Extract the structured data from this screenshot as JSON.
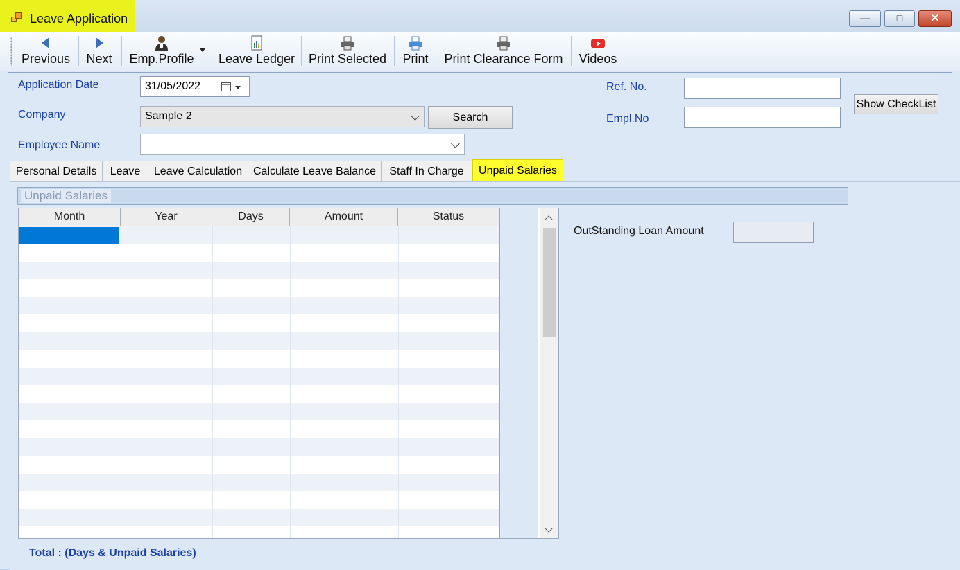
{
  "window": {
    "title": "Leave Application",
    "icon": "app-window-icon",
    "highlight_color": "#e9f21c",
    "controls": [
      "minimize",
      "maximize",
      "close"
    ]
  },
  "toolbar": {
    "items": [
      {
        "label": "Previous",
        "icon": "arrow-left-icon"
      },
      {
        "label": "Next",
        "icon": "arrow-right-icon"
      },
      {
        "label": "Emp.Profile",
        "icon": "person-icon",
        "dropdown": true
      },
      {
        "label": "Leave Ledger",
        "icon": "ledger-icon"
      },
      {
        "label": "Print Selected",
        "icon": "printer-icon"
      },
      {
        "label": "Print",
        "icon": "printer-icon"
      },
      {
        "label": "Print Clearance Form",
        "icon": "printer-icon"
      },
      {
        "label": "Videos",
        "icon": "youtube-icon"
      }
    ]
  },
  "form": {
    "application_date_label": "Application Date",
    "application_date_value": "31/05/2022",
    "company_label": "Company",
    "company_value": "Sample 2",
    "search_button": "Search",
    "employee_name_label": "Employee Name",
    "employee_name_value": "",
    "ref_no_label": "Ref. No.",
    "ref_no_value": "",
    "empl_no_label": "Empl.No",
    "empl_no_value": "",
    "show_checklist_button": "Show CheckList"
  },
  "tabs": [
    {
      "label": "Personal Details",
      "active": false
    },
    {
      "label": "Leave",
      "active": false
    },
    {
      "label": "Leave Calculation",
      "active": false
    },
    {
      "label": "Calculate Leave Balance",
      "active": false
    },
    {
      "label": "Staff In Charge",
      "active": false
    },
    {
      "label": "Unpaid Salaries",
      "active": true
    }
  ],
  "unpaid": {
    "group_title": "Unpaid Salaries",
    "columns": [
      "Month",
      "Year",
      "Days",
      "Amount",
      "Status"
    ],
    "rows": [],
    "outstanding_loan_label": "OutStanding Loan Amount",
    "outstanding_loan_value": "",
    "total_label": "Total :  (Days  & Unpaid Salaries)"
  },
  "colors": {
    "label_blue": "#1a3ea6",
    "selection_blue": "#0078d7",
    "active_tab_yellow": "#ffff2e"
  }
}
